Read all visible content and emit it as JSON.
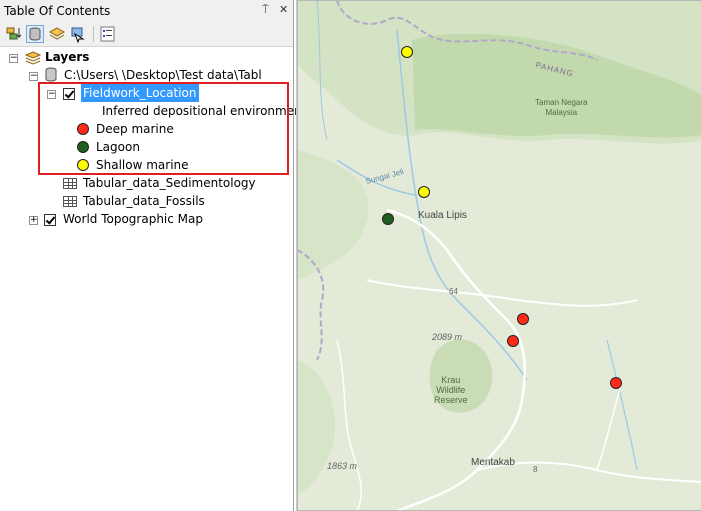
{
  "window": {
    "title": "Table Of Contents",
    "pin_glyph": "⍑",
    "close_glyph": "✕"
  },
  "toolbar": {
    "tools": [
      {
        "name": "list-by-drawing-order",
        "active": false
      },
      {
        "name": "list-by-source",
        "active": true
      },
      {
        "name": "list-by-visibility",
        "active": false
      },
      {
        "name": "list-by-selection",
        "active": false
      },
      {
        "name": "options",
        "active": false
      }
    ]
  },
  "tree": {
    "root_label": "Layers",
    "database_label": "C:\\Users\\             \\Desktop\\Test data\\Tabl",
    "layer_label": "Fieldwork_Location",
    "legend_heading": "Inferred depositional environment",
    "legend": [
      {
        "label": "Deep marine",
        "color": "#ff2a1a"
      },
      {
        "label": "Lagoon",
        "color": "#1f5e1f"
      },
      {
        "label": "Shallow marine",
        "color": "#ffff00"
      }
    ],
    "tables": [
      {
        "label": "Tabular_data_Sedimentology"
      },
      {
        "label": "Tabular_data_Fossils"
      }
    ],
    "basemap_label": "World Topographic Map"
  },
  "colors": {
    "highlight": "#3399ff",
    "red_box": "#e0201e",
    "map_bg": "#e3ead7",
    "map_forest": "#cfe0bf",
    "map_river": "#9fc7e8",
    "map_road": "#ffffff"
  },
  "map": {
    "labels": {
      "pahang": "PAHANG",
      "park": "Taman Negara\nMalaysia",
      "sungai": "Sungai Jeli",
      "kuala_lipis": "Kuala Lipis",
      "route64": "64",
      "elev2089": "2089 m",
      "krau": "Krau\nWildlife\nReserve",
      "elev1863": "1863 m",
      "mentakab": "Mentakab",
      "route8": "8"
    },
    "points": [
      {
        "type": "Shallow marine",
        "color": "#ffff00"
      },
      {
        "type": "Shallow marine",
        "color": "#ffff00"
      },
      {
        "type": "Lagoon",
        "color": "#1f5e1f"
      },
      {
        "type": "Deep marine",
        "color": "#ff2a1a"
      },
      {
        "type": "Deep marine",
        "color": "#ff2a1a"
      },
      {
        "type": "Deep marine",
        "color": "#ff2a1a"
      }
    ]
  }
}
